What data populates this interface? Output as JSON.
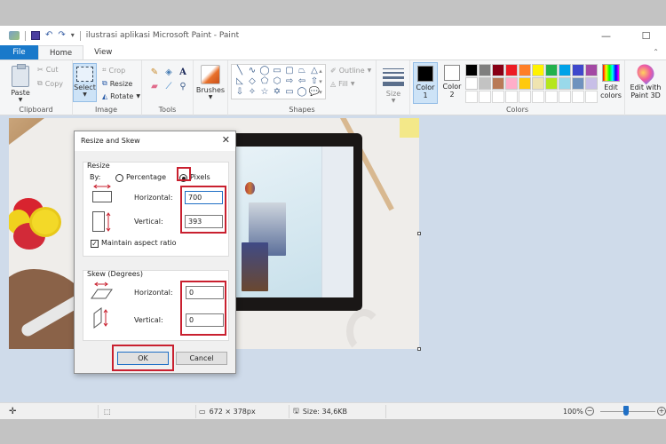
{
  "window": {
    "title": "ilustrasi aplikasi Microsoft Paint - Paint",
    "minimize_glyph": "—",
    "maximize_glyph": "☐"
  },
  "tabs": [
    {
      "label": "File",
      "active": false
    },
    {
      "label": "Home",
      "active": true
    },
    {
      "label": "View",
      "active": false
    }
  ],
  "ribbon": {
    "clipboard": {
      "paste": "Paste",
      "cut": "Cut",
      "copy": "Copy",
      "label": "Clipboard"
    },
    "image": {
      "select": "Select",
      "crop": "Crop",
      "resize": "Resize",
      "rotate": "Rotate",
      "label": "Image"
    },
    "tools": {
      "label": "Tools",
      "items": [
        "pencil",
        "fill",
        "text",
        "eraser",
        "color-picker",
        "magnifier"
      ]
    },
    "brushes": {
      "label": "Brushes"
    },
    "shapes": {
      "label": "Shapes",
      "outline": "Outline",
      "fill": "Fill",
      "glyphs": [
        "╲",
        "∿",
        "◯",
        "▭",
        "▢",
        "⏢",
        "△",
        "◺",
        "◇",
        "⬠",
        "⬡",
        "⇨",
        "⇦",
        "⇧",
        "⇩",
        "✧",
        "☆",
        "✡",
        "▭",
        "◯",
        "💬"
      ]
    },
    "size": {
      "label": "Size"
    },
    "color1": {
      "label_line1": "Color",
      "label_line2": "1",
      "value": "#000000"
    },
    "color2": {
      "label_line1": "Color",
      "label_line2": "2",
      "value": "#ffffff"
    },
    "palette": [
      "#000000",
      "#7f7f7f",
      "#880015",
      "#ed1c24",
      "#ff7f27",
      "#fff200",
      "#22b14c",
      "#00a2e8",
      "#3f48cc",
      "#a349a4",
      "#ffffff",
      "#c3c3c3",
      "#b97a57",
      "#ffaec9",
      "#ffc90e",
      "#efe4b0",
      "#b5e61d",
      "#99d9ea",
      "#7092be",
      "#c8bfe7",
      "#ffffff",
      "#ffffff",
      "#ffffff",
      "#ffffff",
      "#ffffff",
      "#ffffff",
      "#ffffff",
      "#ffffff",
      "#ffffff",
      "#ffffff"
    ],
    "colors_label": "Colors",
    "edit_colors": {
      "line1": "Edit",
      "line2": "colors"
    },
    "paint3d": {
      "line1": "Edit with",
      "line2": "Paint 3D"
    }
  },
  "dialog": {
    "title": "Resize and Skew",
    "close_glyph": "✕",
    "resize": {
      "legend": "Resize",
      "by_label": "By:",
      "percentage_label": "Percentage",
      "pixels_label": "Pixels",
      "selected_mode": "Pixels",
      "horizontal_label": "Horizontal:",
      "horizontal_value": "700",
      "vertical_label": "Vertical:",
      "vertical_value": "393",
      "maintain_aspect_label": "Maintain aspect ratio",
      "maintain_aspect_checked": true
    },
    "skew": {
      "legend": "Skew (Degrees)",
      "horizontal_label": "Horizontal:",
      "horizontal_value": "0",
      "vertical_label": "Vertical:",
      "vertical_value": "0"
    },
    "ok_label": "OK",
    "cancel_label": "Cancel",
    "highlight_color": "#c9202f"
  },
  "status": {
    "image_dimensions": "672 × 378px",
    "size": "Size: 34,6KB",
    "zoom": "100%",
    "zoom_out_glyph": "−",
    "zoom_in_glyph": "+"
  }
}
